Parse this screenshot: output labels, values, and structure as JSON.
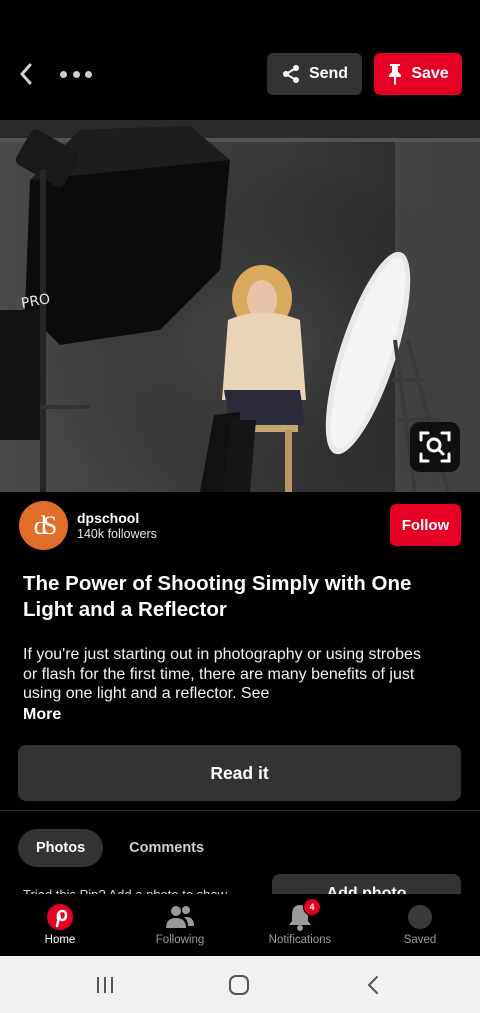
{
  "header": {
    "send_label": "Send",
    "save_label": "Save"
  },
  "author": {
    "avatar_text": "dS",
    "name": "dpschool",
    "followers": "140k followers",
    "follow_label": "Follow"
  },
  "pin": {
    "title": "The Power of Shooting Simply with One Light and a Reflector",
    "description": "If you're just starting out in photography or using strobes or flash for the first time, there are many benefits of just using one light and a reflector. See",
    "more_label": "More",
    "read_label": "Read it"
  },
  "tabs": [
    {
      "label": "Photos",
      "active": true
    },
    {
      "label": "Comments",
      "active": false
    }
  ],
  "peek": {
    "text": "Tried this Pin? Add a photo to show",
    "button_label": "Add photo"
  },
  "bottom_nav": [
    {
      "label": "Home",
      "icon": "pinterest-logo-icon",
      "active": true
    },
    {
      "label": "Following",
      "icon": "people-icon",
      "active": false
    },
    {
      "label": "Notifications",
      "icon": "bell-icon",
      "active": false,
      "badge": "4"
    },
    {
      "label": "Saved",
      "icon": "profile-avatar-icon",
      "active": false
    }
  ],
  "colors": {
    "brand_red": "#e60023",
    "button_dark": "#333333",
    "background": "#000000"
  }
}
